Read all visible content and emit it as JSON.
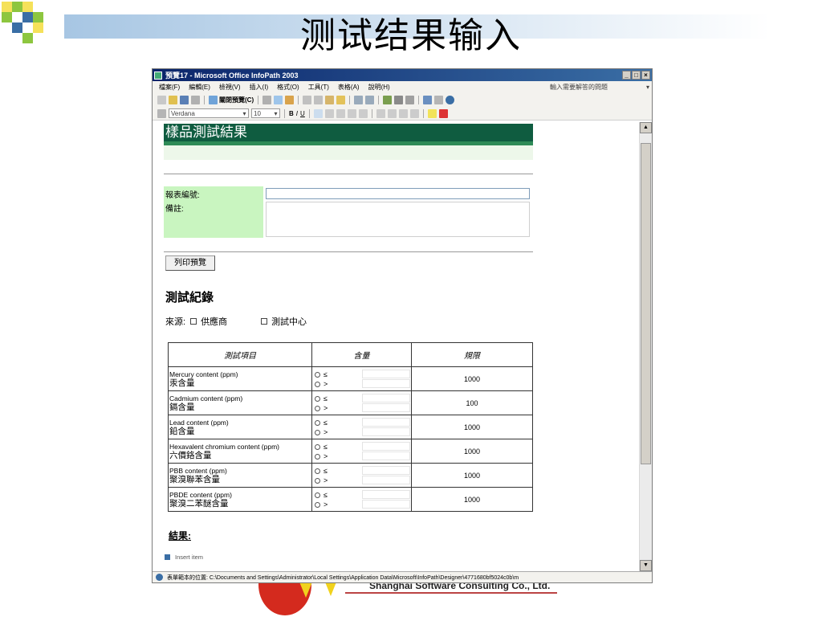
{
  "slide": {
    "title": "测试结果输入"
  },
  "decoration": {
    "caption": "Shanghai Software Consulting Co., Ltd."
  },
  "window": {
    "title": "預覽17 - Microsoft Office InfoPath 2003",
    "controls": [
      "_",
      "□",
      "×"
    ]
  },
  "menu": {
    "items": [
      "檔案(F)",
      "編輯(E)",
      "檢視(V)",
      "插入(I)",
      "格式(O)",
      "工具(T)",
      "表格(A)",
      "說明(H)"
    ],
    "help_placeholder": "輸入需要解答的問題"
  },
  "toolbar": {
    "close_preview": "關閉預覽(C)"
  },
  "format_bar": {
    "font": "Verdana",
    "size": "10"
  },
  "form": {
    "title": "樣品測試結果",
    "report_no_label": "報表編號:",
    "report_no_value": "",
    "remark_label": "備註:",
    "remark_value": "",
    "print_button": "列印預覽",
    "records_title": "測試紀錄",
    "source_label": "來源:",
    "source_options": [
      "供應商",
      "測試中心"
    ],
    "table_headers": [
      "測試項目",
      "含量",
      "規限"
    ],
    "rows": [
      {
        "en": "Mercury content (ppm)",
        "zh": "汞含量",
        "le": "≤",
        "gt": ">",
        "limit": "1000"
      },
      {
        "en": "Cadmium content (ppm)",
        "zh": "鎘含量",
        "le": "≤",
        "gt": ">",
        "limit": "100"
      },
      {
        "en": "Lead content (ppm)",
        "zh": "鉛含量",
        "le": "≤",
        "gt": ">",
        "limit": "1000"
      },
      {
        "en": "Hexavalent chromium content (ppm)",
        "zh": "六價鉻含量",
        "le": "≤",
        "gt": ">",
        "limit": "1000"
      },
      {
        "en": "PBB content (ppm)",
        "zh": "聚溴聯苯含量",
        "le": "≤",
        "gt": ">",
        "limit": "1000"
      },
      {
        "en": "PBDE content (ppm)",
        "zh": "聚溴二苯醚含量",
        "le": "≤",
        "gt": ">",
        "limit": "1000"
      }
    ],
    "result_label": "結果:",
    "insert_item": "Insert item"
  },
  "status": {
    "text": "表單範本的位置: C:\\Documents and Settings\\Administrator\\Local Settings\\Application Data\\Microsoft\\InfoPath\\Designer\\4771680bf5024c0b\\m"
  },
  "colors": {
    "header": "#0f5c40",
    "label_panel": "#c9f5c0",
    "title_bar": "#0a246a"
  }
}
